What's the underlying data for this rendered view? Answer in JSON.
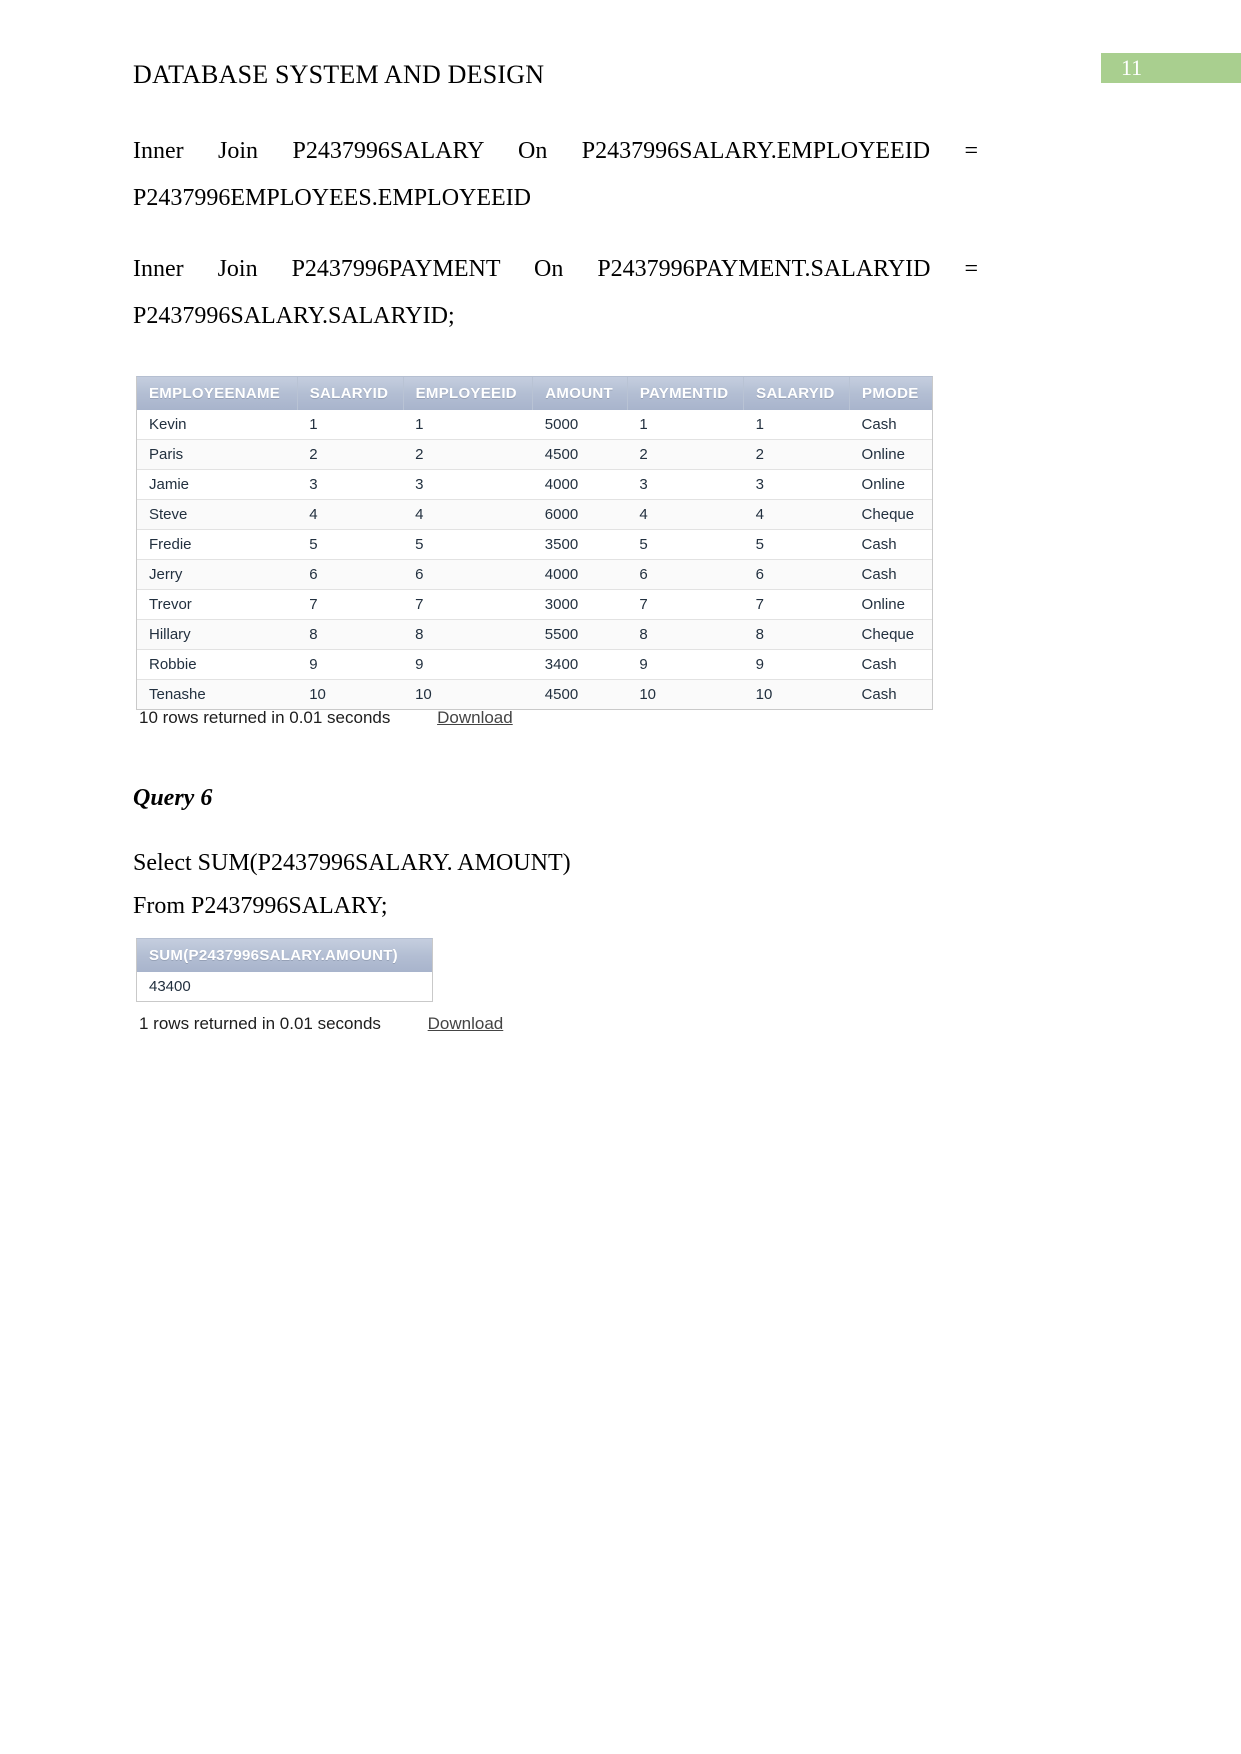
{
  "header": {
    "doc_title": "DATABASE SYSTEM AND DESIGN",
    "page_number": "11",
    "badge_color": "#a9cf8f"
  },
  "sql_block_1": {
    "line1_a": "Inner",
    "line1_b": "Join",
    "line1_c": "P2437996SALARY",
    "line1_d": "On",
    "line1_e": "P2437996SALARY.EMPLOYEEID",
    "line1_f": "=",
    "line2": "P2437996EMPLOYEES.EMPLOYEEID"
  },
  "sql_block_2": {
    "line1_a": "Inner",
    "line1_b": "Join",
    "line1_c": "P2437996PAYMENT",
    "line1_d": "On",
    "line1_e": "P2437996PAYMENT.SALARYID",
    "line1_f": "=",
    "line2": "P2437996SALARY.SALARYID;"
  },
  "result_table_1": {
    "columns": [
      "EMPLOYEENAME",
      "SALARYID",
      "EMPLOYEEID",
      "AMOUNT",
      "PAYMENTID",
      "SALARYID",
      "PMODE"
    ],
    "rows": [
      [
        "Kevin",
        "1",
        "1",
        "5000",
        "1",
        "1",
        "Cash"
      ],
      [
        "Paris",
        "2",
        "2",
        "4500",
        "2",
        "2",
        "Online"
      ],
      [
        "Jamie",
        "3",
        "3",
        "4000",
        "3",
        "3",
        "Online"
      ],
      [
        "Steve",
        "4",
        "4",
        "6000",
        "4",
        "4",
        "Cheque"
      ],
      [
        "Fredie",
        "5",
        "5",
        "3500",
        "5",
        "5",
        "Cash"
      ],
      [
        "Jerry",
        "6",
        "6",
        "4000",
        "6",
        "6",
        "Cash"
      ],
      [
        "Trevor",
        "7",
        "7",
        "3000",
        "7",
        "7",
        "Online"
      ],
      [
        "Hillary",
        "8",
        "8",
        "5500",
        "8",
        "8",
        "Cheque"
      ],
      [
        "Robbie",
        "9",
        "9",
        "3400",
        "9",
        "9",
        "Cash"
      ],
      [
        "Tenashe",
        "10",
        "10",
        "4500",
        "10",
        "10",
        "Cash"
      ]
    ],
    "footer_rows_text": "10 rows returned in 0.01 seconds",
    "footer_download_label": "Download"
  },
  "query6": {
    "heading": "Query 6",
    "select_line": "Select SUM(P2437996SALARY. AMOUNT)",
    "from_line": "From P2437996SALARY;"
  },
  "result_table_2": {
    "columns": [
      "SUM(P2437996SALARY.AMOUNT)"
    ],
    "rows": [
      [
        "43400"
      ]
    ],
    "footer_rows_text": "1 rows returned in 0.01 seconds",
    "footer_download_label": "Download"
  }
}
